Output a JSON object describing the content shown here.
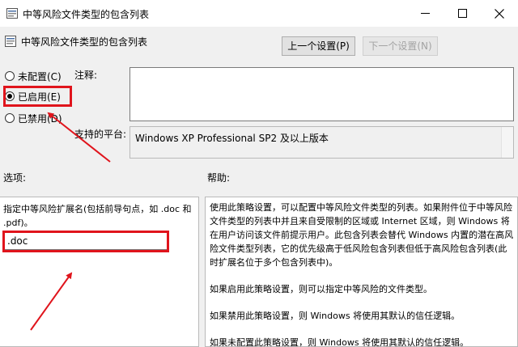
{
  "window": {
    "title": "中等风险文件类型的包含列表",
    "minimize_icon": "minimize-icon",
    "maximize_icon": "maximize-icon",
    "close_icon": "close-icon"
  },
  "header": {
    "title": "中等风险文件类型的包含列表",
    "prev_label": "上一个设置(P)",
    "next_label": "下一个设置(N)"
  },
  "state": {
    "not_configured": "未配置(C)",
    "enabled": "已启用(E)",
    "disabled": "已禁用(D)",
    "selected": "enabled"
  },
  "comment": {
    "label": "注释:",
    "value": ""
  },
  "platform": {
    "label": "支持的平台:",
    "value": "Windows XP Professional SP2 及以上版本"
  },
  "options": {
    "label": "选项:",
    "description": "指定中等风险扩展名(包括前导句点，如 .doc 和 .pdf)。",
    "extension_value": ".doc"
  },
  "help": {
    "label": "帮助:",
    "paragraphs": [
      "使用此策略设置，可以配置中等风险文件类型的列表。如果附件位于中等风险文件类型的列表中并且来自受限制的区域或 Internet 区域，则 Windows 将在用户访问该文件前提示用户。此包含列表会替代 Windows 内置的潜在高风险文件类型列表，它的优先级高于低风险包含列表但低于高风险包含列表(此时扩展名位于多个包含列表中)。",
      "如果启用此策略设置，则可以指定中等风险的文件类型。",
      "如果禁用此策略设置，则 Windows 将使用其默认的信任逻辑。",
      "如果未配置此策略设置，则 Windows 将使用其默认的信任逻辑。"
    ]
  },
  "colors": {
    "annotation_red": "#e0141c",
    "window_bg": "#f0f0f0"
  }
}
